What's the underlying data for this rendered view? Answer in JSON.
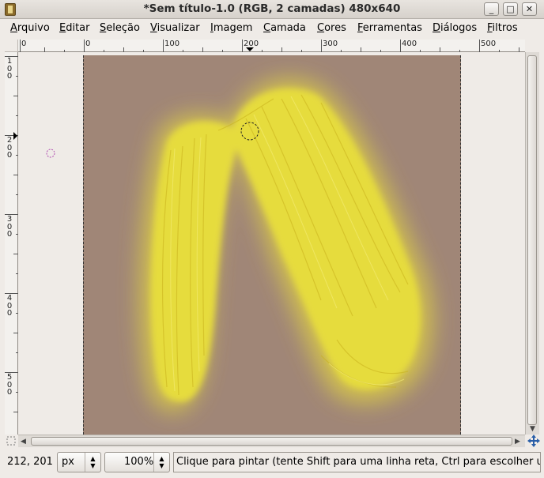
{
  "window": {
    "title": "*Sem título-1.0 (RGB, 2 camadas) 480x640",
    "minimize_glyph": "_",
    "maximize_glyph": "□",
    "close_glyph": "✕"
  },
  "menu": [
    {
      "accel": "A",
      "rest": "rquivo"
    },
    {
      "accel": "E",
      "rest": "ditar"
    },
    {
      "accel": "S",
      "rest": "eleção"
    },
    {
      "accel": "V",
      "rest": "isualizar"
    },
    {
      "accel": "I",
      "rest": "magem"
    },
    {
      "accel": "C",
      "rest": "amada"
    },
    {
      "accel": "C",
      "rest": "ores"
    },
    {
      "accel": "F",
      "rest": "erramentas"
    },
    {
      "accel": "D",
      "rest": "iálogos"
    },
    {
      "accel": "F",
      "rest": "iltros"
    }
  ],
  "rulers": {
    "horizontal_labels": [
      "0",
      "0",
      "100",
      "200",
      "300",
      "400",
      "500"
    ],
    "vertical_labels": [
      "1\n0\n0",
      "2\n0\n0",
      "3\n0\n0",
      "4\n0\n0",
      "5\n0\n0"
    ]
  },
  "canvas": {
    "background_color": "#a08677",
    "hair_color": "#e6dc3c"
  },
  "status": {
    "coordinates": "212, 201",
    "unit": "px",
    "zoom": "100%",
    "message": "Clique para pintar (tente Shift para uma linha reta, Ctrl para escolher u..."
  },
  "icons": {
    "navigate": "move-arrows-icon",
    "quick_mask": "quick-mask-icon",
    "brush_cursor": "brush-outline-icon"
  }
}
